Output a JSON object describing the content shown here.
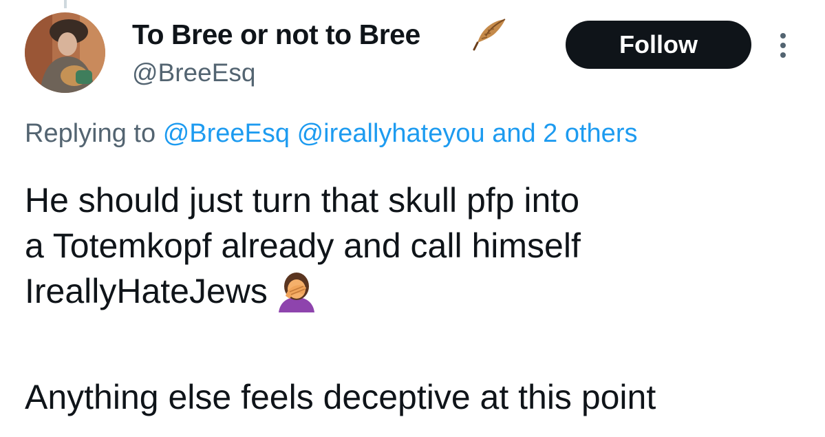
{
  "author": {
    "display_name": "To Bree or not to Bree",
    "name_emoji": "feather-icon",
    "handle": "@BreeEsq",
    "avatar": "avatar"
  },
  "actions": {
    "follow_label": "Follow",
    "more_icon": "more-vertical-icon"
  },
  "reply_context": {
    "prefix": "Replying to",
    "mentions": [
      "@BreeEsq",
      "@ireallyhateyou"
    ],
    "others": "and 2 others"
  },
  "tweet": {
    "lines": [
      "He should just turn that skull pfp into",
      "a Totemkopf already and call himself",
      "IreallyHateJews"
    ],
    "emoji": "facepalm-icon",
    "last_line": "Anything else feels deceptive at this point"
  },
  "colors": {
    "text": "#0f1419",
    "secondary": "#536471",
    "link": "#1d9bf0",
    "button_bg": "#0f1419",
    "button_text": "#ffffff"
  }
}
